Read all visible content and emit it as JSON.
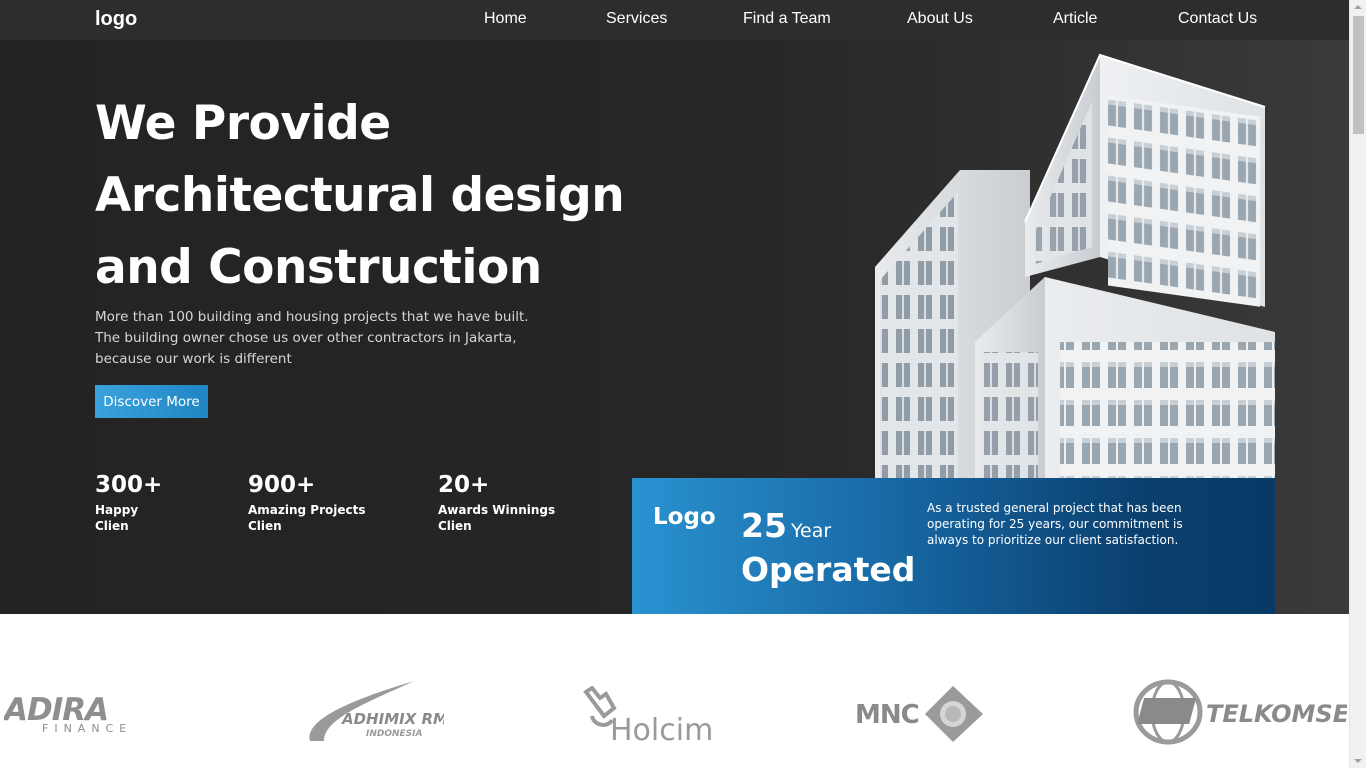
{
  "nav": {
    "logo": "logo",
    "items": [
      "Home",
      "Services",
      "Find a Team",
      "About Us",
      "Article",
      "Contact Us"
    ]
  },
  "hero": {
    "headline": [
      "We Provide",
      "Architectural design",
      "and Construction"
    ],
    "subtext": "More than 100 building and housing projects that we have built. The building owner chose us over other contractors in Jakarta, because our work is different",
    "cta": "Discover More",
    "stats": [
      {
        "num": "300+",
        "line1": "Happy",
        "line2": "Clien"
      },
      {
        "num": "900+",
        "line1": "Amazing Projects",
        "line2": "Clien"
      },
      {
        "num": "20+",
        "line1": "Awards Winnings",
        "line2": "Clien"
      }
    ]
  },
  "banner": {
    "logo": "Logo",
    "years_number": "25",
    "years_unit": "Year",
    "operated": "Operated",
    "description": "As a trusted general project that has been operating for 25 years, our commitment is always to prioritize our client satisfaction."
  },
  "partners": {
    "adira_main": "ADIRA",
    "adira_sub": "FINANCE",
    "adhimix_main": "ADHIMIX RMC",
    "adhimix_sub": "INDONESIA",
    "holcim": "Holcim",
    "mnc": "MNC",
    "telkomsel": "TELKOMSEL"
  },
  "colors": {
    "nav_bg": "#2d2d2d",
    "hero_bg": "#232323",
    "accent": "#2a92d1",
    "banner_dark": "#093a66",
    "partner_gray": "#8e8e8e"
  }
}
